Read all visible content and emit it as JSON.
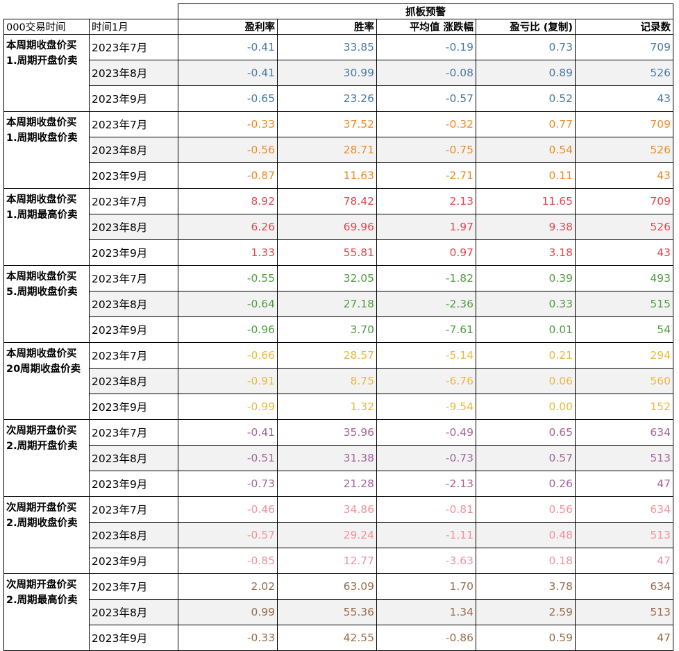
{
  "header": {
    "corner_label": "000交易时间",
    "month_label": "时间1月",
    "group_title": "抓板预警",
    "columns": [
      "盈利率",
      "胜率",
      "平均值 涨跌幅",
      "盈亏比 (复制)",
      "记录数"
    ]
  },
  "groups": [
    {
      "label_line1": "本周期收盘价买",
      "label_line2": "1.周期开盘价卖",
      "color": "#4a78a8",
      "rows": [
        {
          "month": "2023年7月",
          "v": [
            "-0.41",
            "33.85",
            "-0.19",
            "0.73",
            "709"
          ]
        },
        {
          "month": "2023年8月",
          "v": [
            "-0.41",
            "30.99",
            "-0.08",
            "0.89",
            "526"
          ]
        },
        {
          "month": "2023年9月",
          "v": [
            "-0.65",
            "23.26",
            "-0.57",
            "0.52",
            "43"
          ]
        }
      ]
    },
    {
      "label_line1": "本周期收盘价买",
      "label_line2": "1.周期收盘价卖",
      "color": "#f08a24",
      "rows": [
        {
          "month": "2023年7月",
          "v": [
            "-0.33",
            "37.52",
            "-0.32",
            "0.77",
            "709"
          ]
        },
        {
          "month": "2023年8月",
          "v": [
            "-0.56",
            "28.71",
            "-0.75",
            "0.54",
            "526"
          ]
        },
        {
          "month": "2023年9月",
          "v": [
            "-0.87",
            "11.63",
            "-2.71",
            "0.11",
            "43"
          ]
        }
      ]
    },
    {
      "label_line1": "本周期收盘价买",
      "label_line2": "1.周期最高价卖",
      "color": "#e0474f",
      "rows": [
        {
          "month": "2023年7月",
          "v": [
            "8.92",
            "78.42",
            "2.13",
            "11.65",
            "709"
          ]
        },
        {
          "month": "2023年8月",
          "v": [
            "6.26",
            "69.96",
            "1.97",
            "9.38",
            "526"
          ]
        },
        {
          "month": "2023年9月",
          "v": [
            "1.33",
            "55.81",
            "0.97",
            "3.18",
            "43"
          ]
        }
      ]
    },
    {
      "label_line1": "本周期收盘价买",
      "label_line2": "5.周期收盘价卖",
      "color": "#4e9d3e",
      "rows": [
        {
          "month": "2023年7月",
          "v": [
            "-0.55",
            "32.05",
            "-1.82",
            "0.39",
            "493"
          ]
        },
        {
          "month": "2023年8月",
          "v": [
            "-0.64",
            "27.18",
            "-2.36",
            "0.33",
            "515"
          ]
        },
        {
          "month": "2023年9月",
          "v": [
            "-0.96",
            "3.70",
            "-7.61",
            "0.01",
            "54"
          ]
        }
      ]
    },
    {
      "label_line1": "本周期收盘价买",
      "label_line2": "20周期收盘价卖",
      "color": "#e9b93b",
      "rows": [
        {
          "month": "2023年7月",
          "v": [
            "-0.66",
            "28.57",
            "-5.14",
            "0.21",
            "294"
          ]
        },
        {
          "month": "2023年8月",
          "v": [
            "-0.91",
            "8.75",
            "-6.76",
            "0.06",
            "560"
          ]
        },
        {
          "month": "2023年9月",
          "v": [
            "-0.99",
            "1.32",
            "-9.54",
            "0.00",
            "152"
          ]
        }
      ]
    },
    {
      "label_line1": "次周期开盘价买",
      "label_line2": "2.周期开盘价卖",
      "color": "#a3649a",
      "rows": [
        {
          "month": "2023年7月",
          "v": [
            "-0.41",
            "35.96",
            "-0.49",
            "0.65",
            "634"
          ]
        },
        {
          "month": "2023年8月",
          "v": [
            "-0.51",
            "31.38",
            "-0.73",
            "0.57",
            "513"
          ]
        },
        {
          "month": "2023年9月",
          "v": [
            "-0.73",
            "21.28",
            "-2.13",
            "0.26",
            "47"
          ]
        }
      ]
    },
    {
      "label_line1": "次周期开盘价买",
      "label_line2": "2.周期收盘价卖",
      "color": "#f2919c",
      "rows": [
        {
          "month": "2023年7月",
          "v": [
            "-0.46",
            "34.86",
            "-0.81",
            "0.56",
            "634"
          ]
        },
        {
          "month": "2023年8月",
          "v": [
            "-0.57",
            "29.24",
            "-1.11",
            "0.48",
            "513"
          ]
        },
        {
          "month": "2023年9月",
          "v": [
            "-0.85",
            "12.77",
            "-3.63",
            "0.18",
            "47"
          ]
        }
      ]
    },
    {
      "label_line1": "次周期开盘价买",
      "label_line2": "2.周期最高价卖",
      "color": "#9a6b4a",
      "rows": [
        {
          "month": "2023年7月",
          "v": [
            "2.02",
            "63.09",
            "1.70",
            "3.78",
            "634"
          ]
        },
        {
          "month": "2023年8月",
          "v": [
            "0.99",
            "55.36",
            "1.34",
            "2.59",
            "513"
          ]
        },
        {
          "month": "2023年9月",
          "v": [
            "-0.33",
            "42.55",
            "-0.86",
            "0.59",
            "47"
          ]
        }
      ]
    }
  ]
}
